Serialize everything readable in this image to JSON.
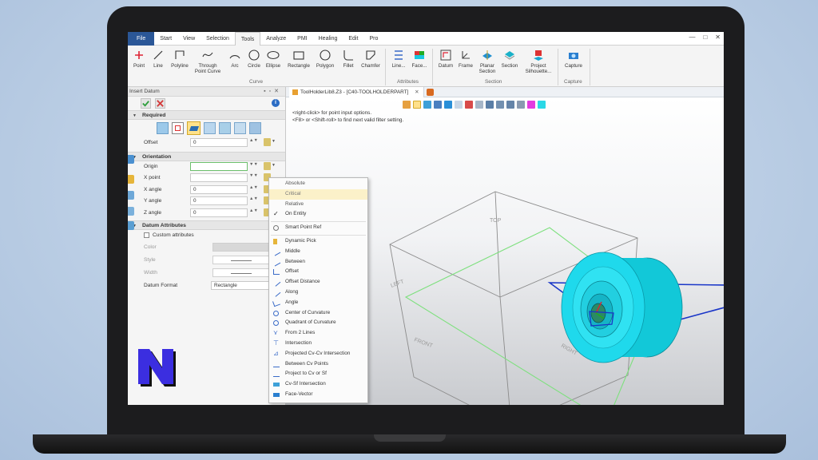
{
  "menu": {
    "tabs": [
      "File",
      "Start",
      "View",
      "Selection",
      "Tools",
      "Analyze",
      "PMI",
      "Healing",
      "Edit",
      "Pro"
    ],
    "active_tab": "Tools",
    "window_buttons": [
      "—",
      "□",
      "✕"
    ]
  },
  "ribbon": {
    "curve_buttons": [
      "Point",
      "Line",
      "Polyline",
      "Through Point Curve",
      "Arc",
      "Circle",
      "Ellipse",
      "Rectangle",
      "Polygon",
      "Fillet",
      "Chamfer"
    ],
    "attribute_buttons": [
      "Line...",
      "Face..."
    ],
    "section_buttons": [
      "Datum",
      "Frame",
      "Planar Section",
      "Section",
      "Project Silhouette..."
    ],
    "capture_buttons": [
      "Capture"
    ],
    "groups": [
      "Curve",
      "Attributes",
      "Section",
      "Capture"
    ]
  },
  "panel": {
    "title": "Insert Datum",
    "sections": {
      "required": "Required",
      "orientation": "Orientation",
      "datum_attributes": "Datum Attributes"
    },
    "offset": {
      "label": "Offset",
      "value": "0"
    },
    "orientation_fields": [
      {
        "label": "Origin",
        "value": ""
      },
      {
        "label": "X point",
        "value": ""
      },
      {
        "label": "X angle",
        "value": "0"
      },
      {
        "label": "Y angle",
        "value": "0"
      },
      {
        "label": "Z angle",
        "value": "0"
      }
    ],
    "custom_attributes": "Custom attributes",
    "color_label": "Color",
    "style_label": "Style",
    "width_label": "Width",
    "datum_format": {
      "label": "Datum Format",
      "value": "Rectangle"
    }
  },
  "viewport": {
    "doc_tab": "ToolHolderLib8.Z3 - [C40-TOOLHOLDERPART]",
    "hint_1": "<right-click> for point input options.",
    "hint_2": "<F8> or <Shift-roll> to find next valid filter setting.",
    "view_labels": {
      "top": "TOP",
      "left": "LEFT",
      "front": "FRONT",
      "right": "RIGHT"
    }
  },
  "dropdown": {
    "items_group1": [
      "Absolute",
      "Critical",
      "Relative",
      "On Entity"
    ],
    "items_group2": [
      "Smart Point Ref"
    ],
    "items_group3": [
      "Dynamic Pick",
      "Middle",
      "Between",
      "Offset",
      "Offset Distance",
      "Along",
      "Angle",
      "Center of Curvature",
      "Quadrant of Curvature",
      "From 2 Lines",
      "Intersection",
      "Projected Cv-Cv Intersection",
      "Between Cv Points",
      "Project to Cv or Sf",
      "Cv-Sf Intersection",
      "Face-Vector"
    ],
    "checked_item": "On Entity",
    "highlighted_item": "Critical"
  },
  "colors": {
    "accent": "#2b5797",
    "part": "#19d8e8",
    "ok": "#2e9e3c",
    "cancel": "#d33b3b",
    "logo": "#3b2ee0"
  }
}
